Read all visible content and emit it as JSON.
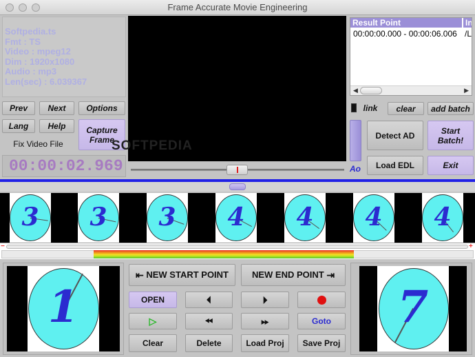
{
  "window": {
    "title": "Frame Accurate Movie Engineering"
  },
  "file_info": {
    "name": "Softpedia.ts",
    "fmt": "Fmt : TS",
    "video": "Video : mpeg12",
    "dim": "Dim : 1920x1080",
    "audio": "Audio : mp3",
    "len": "Len(sec) : 6.039367"
  },
  "nav": {
    "prev": "Prev",
    "next": "Next",
    "options": "Options",
    "lang": "Lang",
    "help": "Help",
    "capture_frame": "Capture Frame",
    "fix_video_file": "Fix Video File"
  },
  "timecode": "00:00:02.969",
  "results": {
    "col_result": "Result Point",
    "col_in": "In",
    "rows": [
      {
        "range": "00:00:00.000 - 00:00:06.006",
        "in": "/L"
      }
    ]
  },
  "batch": {
    "link": "link",
    "clear": "clear",
    "add_batch": "add batch",
    "detect_ad": "Detect AD",
    "start_batch": "Start Batch!",
    "load_edl": "Load EDL",
    "exit": "Exit",
    "ao": "Ao"
  },
  "filmstrip": [
    "3",
    "3",
    "3",
    "4",
    "4",
    "4",
    "4"
  ],
  "timeline_marks": {
    "start": "−",
    "end": "+"
  },
  "controls": {
    "new_start_point": "NEW START POINT",
    "new_end_point": "NEW END POINT",
    "open": "OPEN",
    "goto": "Goto",
    "clear": "Clear",
    "delete": "Delete",
    "load_proj": "Load Proj",
    "save_proj": "Save Proj"
  },
  "start_preview": {
    "digit": "1"
  },
  "end_preview": {
    "digit": "7"
  },
  "watermark": "SOFTPEDIA",
  "colors": {
    "accent": "#2020e6",
    "purple_button": "#c8baeb",
    "info_text": "#b0b0e3",
    "record": "#e01010"
  },
  "icons": {
    "prev_frame": "prev-frame-icon",
    "next_frame": "next-frame-icon",
    "rewind": "rewind-icon",
    "fast_forward": "fast-forward-icon",
    "play": "play-icon",
    "record": "record-icon"
  }
}
